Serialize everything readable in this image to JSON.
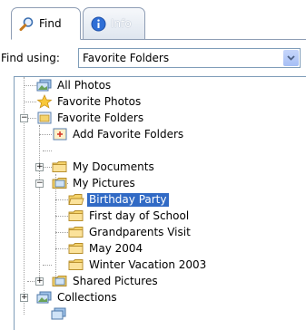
{
  "tabs": [
    {
      "label": "Find",
      "icon": "magnifier-icon",
      "active": true
    },
    {
      "label": "Info",
      "icon": "info-icon",
      "active": false
    }
  ],
  "find_using": {
    "label": "Find using:",
    "selected": "Favorite Folders"
  },
  "tree": {
    "all_photos": "All Photos",
    "favorite_photos": "Favorite Photos",
    "favorite_folders": "Favorite Folders",
    "add_favorite_folders": "Add Favorite Folders",
    "my_documents": "My Documents",
    "my_pictures": "My Pictures",
    "birthday_party": "Birthday Party",
    "first_day_of_school": "First day of School",
    "grandparents_visit": "Grandparents Visit",
    "may_2004": "May 2004",
    "winter_vacation_2003": "Winter Vacation 2003",
    "shared_pictures": "Shared Pictures",
    "collections": "Collections"
  },
  "colors": {
    "selection": "#316ac5",
    "border": "#7f9db9",
    "folder": "#f5d36b"
  }
}
